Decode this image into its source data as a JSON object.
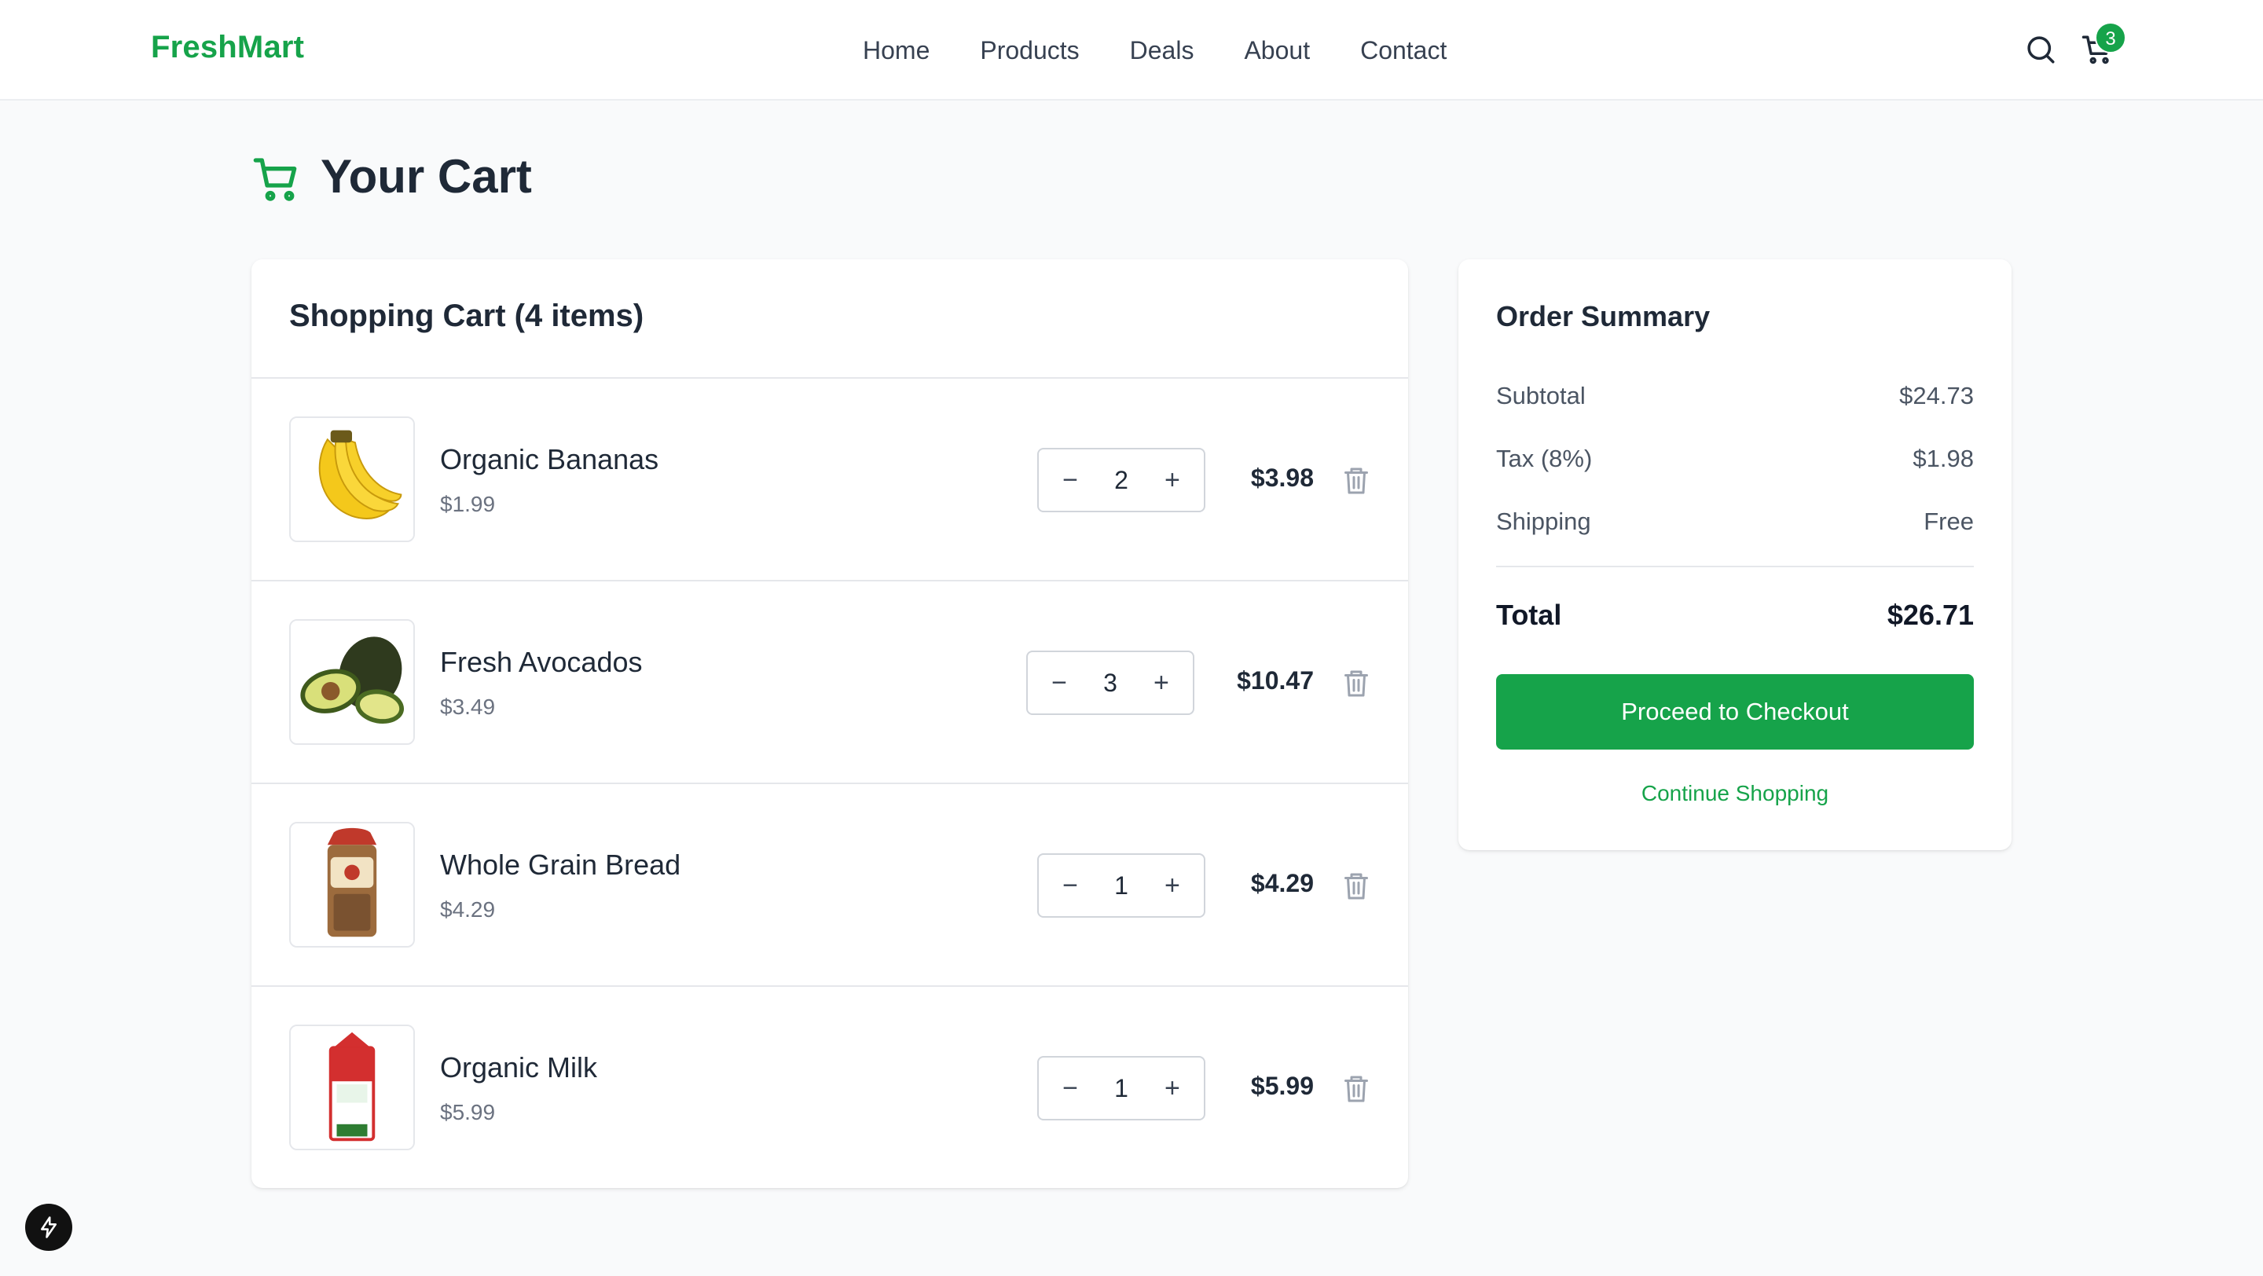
{
  "header": {
    "brand": "FreshMart",
    "nav": [
      "Home",
      "Products",
      "Deals",
      "About",
      "Contact"
    ],
    "cart_count": "3",
    "accent_color": "#16a34a"
  },
  "page": {
    "title": "Your Cart"
  },
  "cart": {
    "heading": "Shopping Cart (4 items)",
    "items": [
      {
        "name": "Organic Bananas",
        "unit_price": "$1.99",
        "quantity": "2",
        "line_total": "$3.98",
        "image": "bananas"
      },
      {
        "name": "Fresh Avocados",
        "unit_price": "$3.49",
        "quantity": "3",
        "line_total": "$10.47",
        "image": "avocados"
      },
      {
        "name": "Whole Grain Bread",
        "unit_price": "$4.29",
        "quantity": "1",
        "line_total": "$4.29",
        "image": "bread"
      },
      {
        "name": "Organic Milk",
        "unit_price": "$5.99",
        "quantity": "1",
        "line_total": "$5.99",
        "image": "milk"
      }
    ],
    "decrement_symbol": "−",
    "increment_symbol": "+"
  },
  "summary": {
    "heading": "Order Summary",
    "subtotal_label": "Subtotal",
    "subtotal_value": "$24.73",
    "tax_label": "Tax (8%)",
    "tax_value": "$1.98",
    "shipping_label": "Shipping",
    "shipping_value": "Free",
    "total_label": "Total",
    "total_value": "$26.71",
    "checkout_label": "Proceed to Checkout",
    "continue_label": "Continue Shopping"
  }
}
